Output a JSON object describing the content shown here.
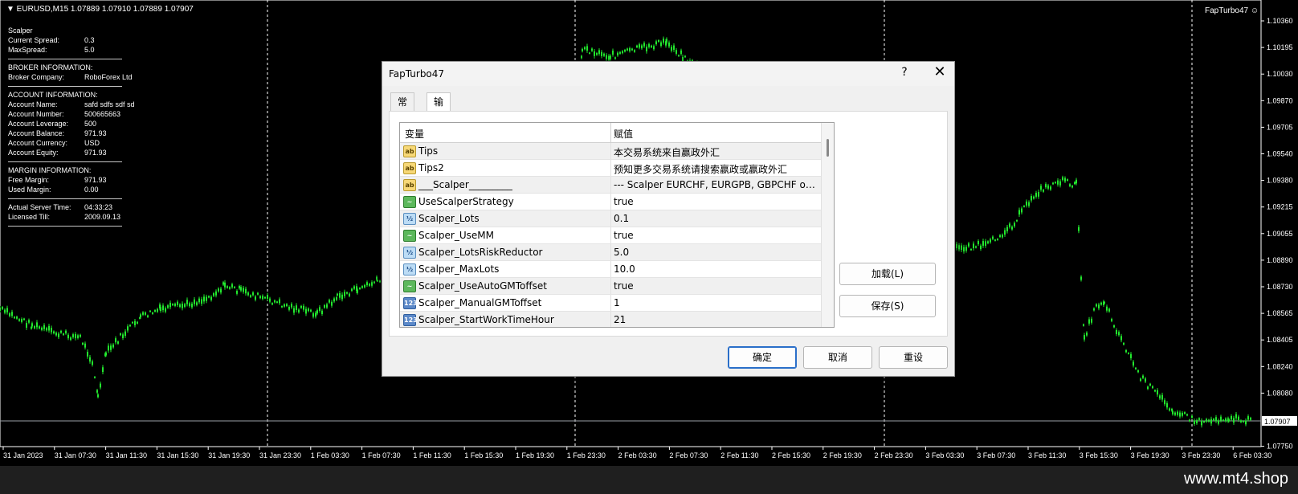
{
  "chart": {
    "symbol_info": "▼ EURUSD,M15  1.07889 1.07910 1.07889 1.07907",
    "ea_name": "FapTurbo47 ☺",
    "current_price": "1.07907",
    "price_labels": [
      "1.10360",
      "1.10195",
      "1.10030",
      "1.09870",
      "1.09705",
      "1.09540",
      "1.09380",
      "1.09215",
      "1.09055",
      "1.08890",
      "1.08730",
      "1.08565",
      "1.08405",
      "1.08240",
      "1.08080",
      "1.07907",
      "1.07750"
    ],
    "time_labels": [
      "31 Jan 2023",
      "31 Jan 07:30",
      "31 Jan 11:30",
      "31 Jan 15:30",
      "31 Jan 19:30",
      "31 Jan 23:30",
      "1 Feb 03:30",
      "1 Feb 07:30",
      "1 Feb 11:30",
      "1 Feb 15:30",
      "1 Feb 19:30",
      "1 Feb 23:30",
      "2 Feb 03:30",
      "2 Feb 07:30",
      "2 Feb 11:30",
      "2 Feb 15:30",
      "2 Feb 19:30",
      "2 Feb 23:30",
      "3 Feb 03:30",
      "3 Feb 07:30",
      "3 Feb 11:30",
      "3 Feb 15:30",
      "3 Feb 19:30",
      "3 Feb 23:30",
      "6 Feb 03:30"
    ]
  },
  "info_panel": {
    "title": "Scalper",
    "current_spread_label": "Current Spread:",
    "current_spread": "0.3",
    "max_spread_label": "MaxSpread:",
    "max_spread": "5.0",
    "broker_header": "BROKER INFORMATION:",
    "broker_company_label": "Broker Company:",
    "broker_company": "RoboForex Ltd",
    "account_header": "ACCOUNT INFORMATION:",
    "account_name_label": "Account Name:",
    "account_name": "safd    sdfs sdf  sd",
    "account_number_label": "Account Number:",
    "account_number": "500665663",
    "account_leverage_label": "Account Leverage:",
    "account_leverage": "500",
    "account_balance_label": "Account Balance:",
    "account_balance": "971.93",
    "account_currency_label": "Account Currency:",
    "account_currency": "USD",
    "account_equity_label": "Account Equity:",
    "account_equity": "971.93",
    "margin_header": "MARGIN INFORMATION:",
    "free_margin_label": "Free Margin:",
    "free_margin": "971.93",
    "used_margin_label": "Used Margin:",
    "used_margin": "0.00",
    "server_time_label": "Actual Server Time:",
    "server_time": "04:33:23",
    "licensed_till_label": "Licensed Till:",
    "licensed_till": "2009.09.13"
  },
  "dialog": {
    "title": "FapTurbo47",
    "help": "?",
    "close": "✕",
    "tabs": [
      "常用",
      "输入参数"
    ],
    "columns": {
      "variable": "变量",
      "value": "赋值"
    },
    "rows": [
      {
        "icon": "ab",
        "icon_type": "string-icon",
        "name": "Tips",
        "value": "本交易系统来自赢政外汇"
      },
      {
        "icon": "ab",
        "icon_type": "string-icon",
        "name": "Tips2",
        "value": "预知更多交易系统请搜索嬴政或嬴政外汇"
      },
      {
        "icon": "ab",
        "icon_type": "string-icon",
        "name": "___Scalper_________",
        "value": "--- Scalper EURCHF, EURGPB, GBPCHF or..."
      },
      {
        "icon": "~",
        "icon_type": "bool-icon",
        "name": "UseScalperStrategy",
        "value": "true"
      },
      {
        "icon": "½",
        "icon_type": "double-icon",
        "name": "Scalper_Lots",
        "value": "0.1"
      },
      {
        "icon": "~",
        "icon_type": "bool-icon",
        "name": "Scalper_UseMM",
        "value": "true"
      },
      {
        "icon": "½",
        "icon_type": "double-icon",
        "name": "Scalper_LotsRiskReductor",
        "value": "5.0"
      },
      {
        "icon": "½",
        "icon_type": "double-icon",
        "name": "Scalper_MaxLots",
        "value": "10.0"
      },
      {
        "icon": "~",
        "icon_type": "bool-icon",
        "name": "Scalper_UseAutoGMToffset",
        "value": "true"
      },
      {
        "icon": "123",
        "icon_type": "int-icon",
        "name": "Scalper_ManualGMToffset",
        "value": "1"
      },
      {
        "icon": "123",
        "icon_type": "int-icon",
        "name": "Scalper_StartWorkTimeHour",
        "value": "21"
      }
    ],
    "load_button": "加载(L)",
    "save_button": "保存(S)",
    "ok_button": "确定",
    "cancel_button": "取消",
    "reset_button": "重设"
  },
  "watermark": "www.mt4.shop"
}
